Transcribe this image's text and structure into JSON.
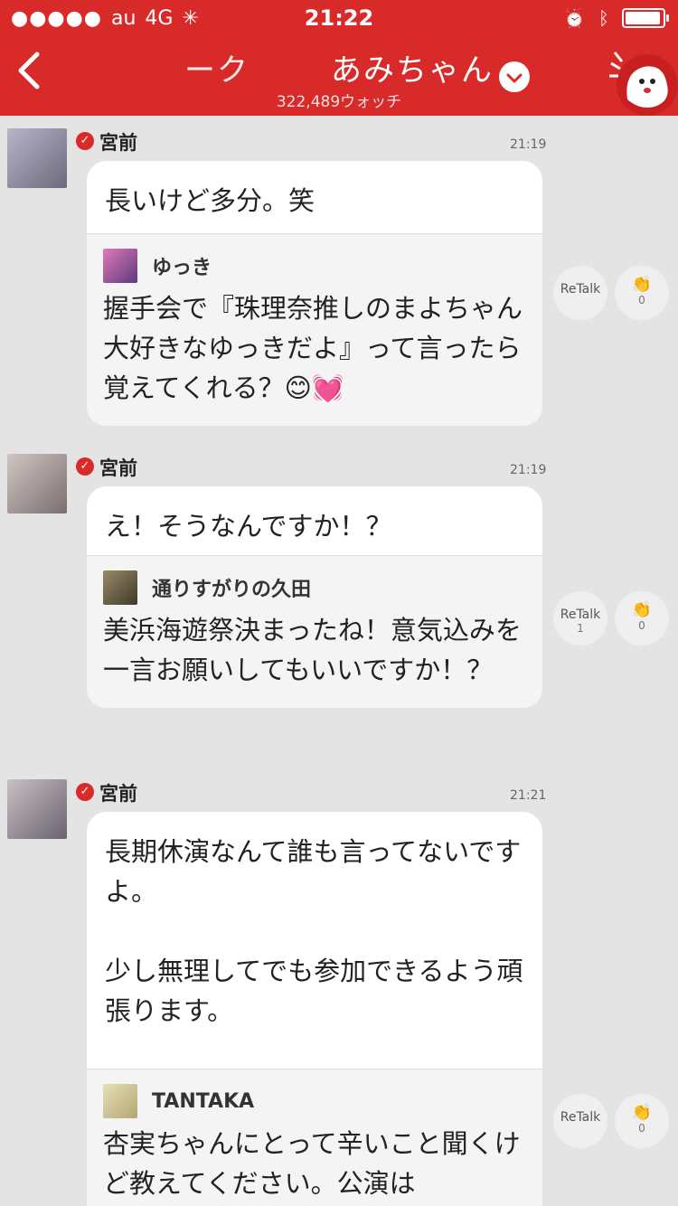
{
  "status_bar": {
    "carrier": "au",
    "network": "4G",
    "time": "21:22"
  },
  "nav": {
    "title_part1": "ーク",
    "title_part2": "あみちゃん",
    "watch_count": "322,489ウォッチ"
  },
  "messages": [
    {
      "name": "宮前",
      "time": "21:19",
      "reply": "長いけど多分。笑",
      "quote_name": "ゆっき",
      "quote_text": "握手会で『珠理奈推しのまよちゃん大好きなゆっきだよ』って言ったら覚えてくれる？😊💓",
      "retalk_label": "ReTalk",
      "retalk_count": "",
      "clap_count": "0"
    },
    {
      "name": "宮前",
      "time": "21:19",
      "reply": "え！そうなんですか！？",
      "quote_name": "通りすがりの久田",
      "quote_text": "美浜海遊祭決まったね！意気込みを一言お願いしてもいいですか！？",
      "retalk_label": "ReTalk",
      "retalk_count": "1",
      "clap_count": "0"
    },
    {
      "name": "宮前",
      "time": "21:21",
      "reply": "長期休演なんて誰も言ってないですよ。\n\n少し無理してでも参加できるよう頑張ります。",
      "quote_name": "TANTAKA",
      "quote_text": "杏実ちゃんにとって辛いこと聞くけど教えてください。公演は",
      "retalk_label": "ReTalk",
      "retalk_count": "",
      "clap_count": "0"
    }
  ],
  "colors": {
    "brand": "#d92a2a",
    "background": "#e4e4e4"
  },
  "icons": [
    "back-icon",
    "chevron-down-icon",
    "mascot-icon",
    "verified-icon",
    "clap-icon",
    "alarm-icon",
    "bluetooth-icon",
    "battery-icon"
  ],
  "battery_level": 0.95
}
